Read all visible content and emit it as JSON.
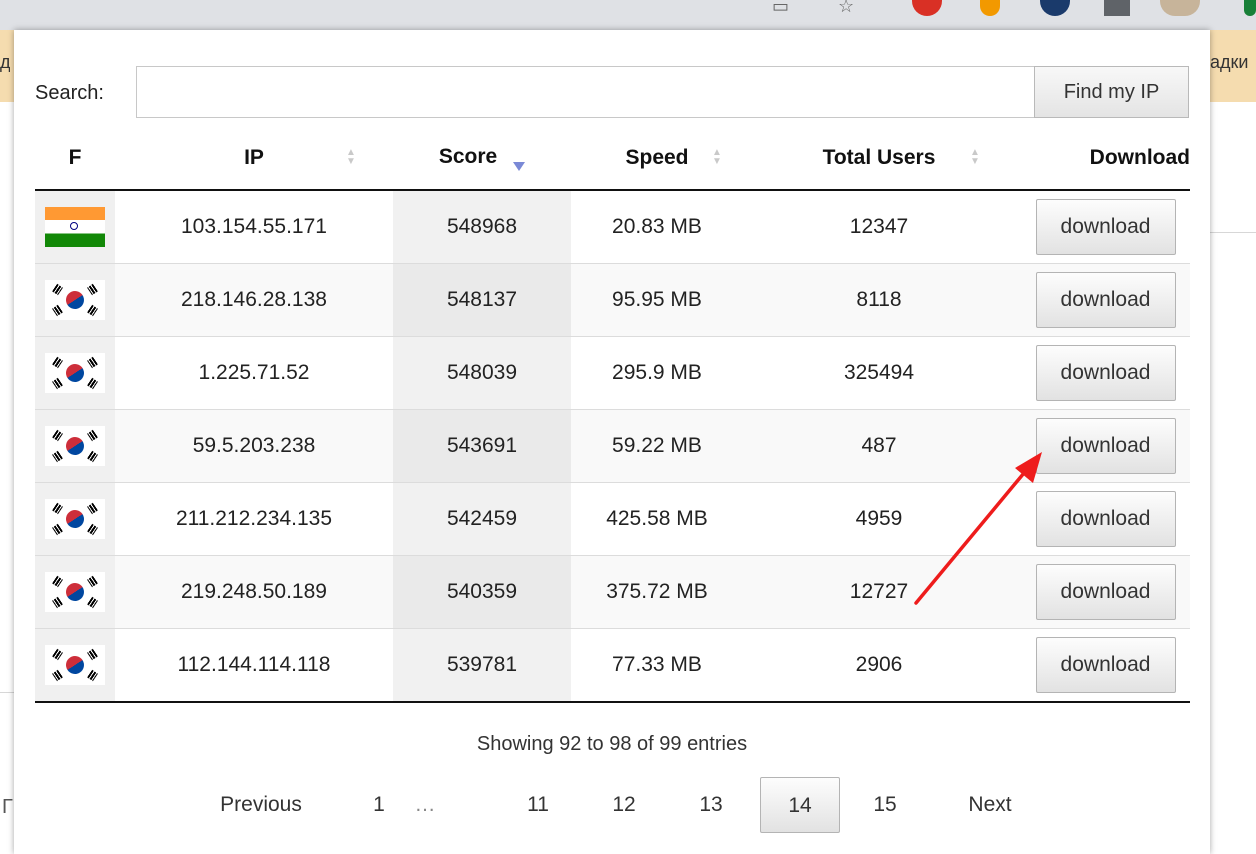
{
  "background": {
    "bookmark_fragment_left": "д",
    "bookmark_fragment_right": "адки",
    "bottom_left_fragment": "Г"
  },
  "search": {
    "label": "Search:",
    "value": "",
    "placeholder": "",
    "find_button": "Find my IP"
  },
  "table": {
    "columns": [
      "F",
      "IP",
      "Score",
      "Speed",
      "Total Users",
      "Download"
    ],
    "sorted_column": "Score",
    "sort_direction": "descending",
    "rows": [
      {
        "flag": "india-flag-icon",
        "ip": "103.154.55.171",
        "score": "548968",
        "speed": "20.83 MB",
        "users": "12347",
        "action": "download"
      },
      {
        "flag": "south-korea-flag-icon",
        "ip": "218.146.28.138",
        "score": "548137",
        "speed": "95.95 MB",
        "users": "8118",
        "action": "download"
      },
      {
        "flag": "south-korea-flag-icon",
        "ip": "1.225.71.52",
        "score": "548039",
        "speed": "295.9 MB",
        "users": "325494",
        "action": "download"
      },
      {
        "flag": "south-korea-flag-icon",
        "ip": "59.5.203.238",
        "score": "543691",
        "speed": "59.22 MB",
        "users": "487",
        "action": "download"
      },
      {
        "flag": "south-korea-flag-icon",
        "ip": "211.212.234.135",
        "score": "542459",
        "speed": "425.58 MB",
        "users": "4959",
        "action": "download"
      },
      {
        "flag": "south-korea-flag-icon",
        "ip": "219.248.50.189",
        "score": "540359",
        "speed": "375.72 MB",
        "users": "12727",
        "action": "download"
      },
      {
        "flag": "south-korea-flag-icon",
        "ip": "112.144.114.118",
        "score": "539781",
        "speed": "77.33 MB",
        "users": "2906",
        "action": "download"
      }
    ]
  },
  "info": "Showing 92 to 98 of 99 entries",
  "pagination": {
    "previous": "Previous",
    "pages": [
      "1",
      "…",
      "11",
      "12",
      "13",
      "14",
      "15"
    ],
    "current": "14",
    "next": "Next"
  },
  "annotation": {
    "type": "red-arrow",
    "color": "#ee1c1c",
    "points_to": "download button in row 4"
  }
}
